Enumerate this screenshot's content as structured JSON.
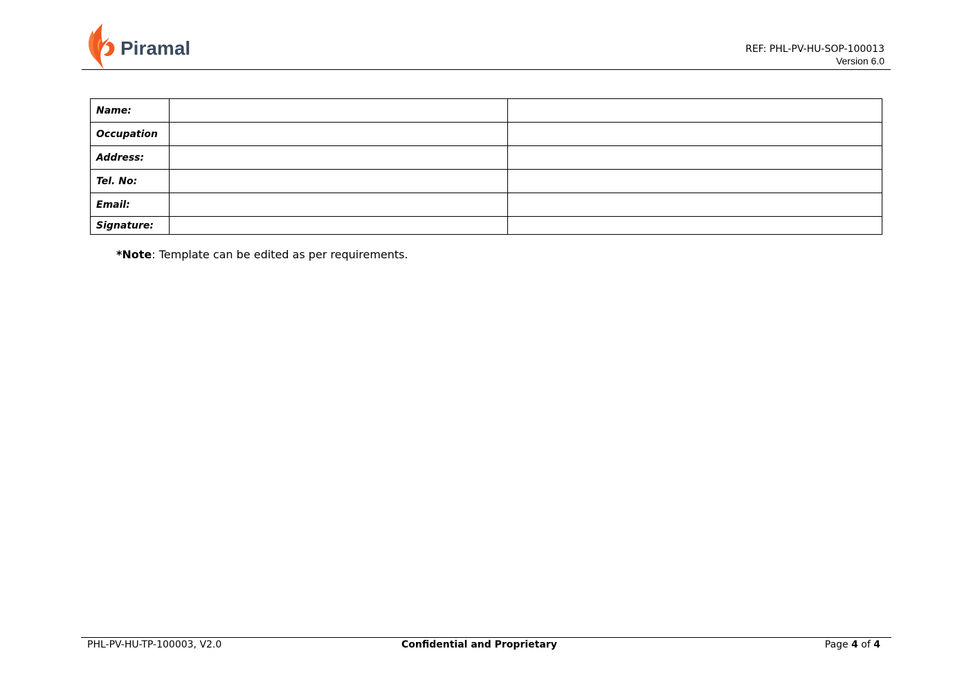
{
  "header": {
    "logo_text": "Piramal",
    "ref": "REF: PHL-PV-HU-SOP-100013",
    "version": "Version 6.0"
  },
  "form": {
    "rows": [
      {
        "label": "Name:",
        "value1": "",
        "value2": ""
      },
      {
        "label": "Occupation",
        "value1": "",
        "value2": ""
      },
      {
        "label": "Address:",
        "value1": "",
        "value2": ""
      },
      {
        "label": "Tel. No:",
        "value1": "",
        "value2": ""
      },
      {
        "label": "Email:",
        "value1": "",
        "value2": ""
      },
      {
        "label": "Signature:",
        "value1": "",
        "value2": ""
      }
    ]
  },
  "note": {
    "prefix": "*Note",
    "text": ": Template can be edited as per requirements."
  },
  "footer": {
    "doc_id": "PHL-PV-HU-TP-100003, V2.0",
    "confidential": "Confidential and Proprietary",
    "page_word": "Page ",
    "page_current": "4",
    "page_of": " of ",
    "page_total": "4"
  },
  "colors": {
    "logo_flame": "#f05a22",
    "logo_text": "#3b4a5e"
  },
  "icons": [
    "piramal-flame-logo-icon"
  ]
}
